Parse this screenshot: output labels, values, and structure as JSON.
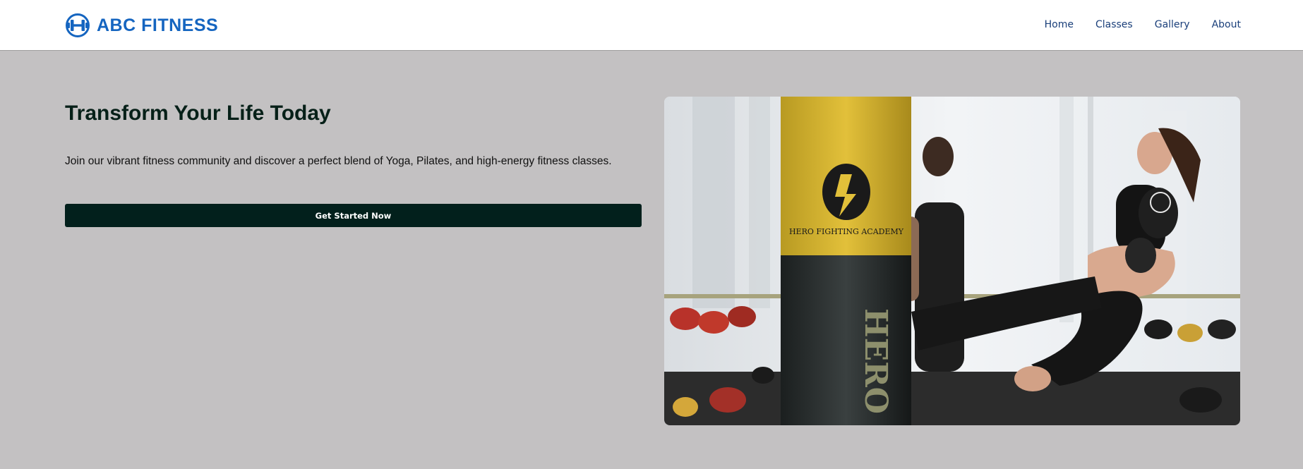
{
  "brand": {
    "name": "ABC FITNESS",
    "logo_icon": "dumbbell-icon",
    "color": "#1565c0"
  },
  "nav": {
    "items": [
      {
        "label": "Home"
      },
      {
        "label": "Classes"
      },
      {
        "label": "Gallery"
      },
      {
        "label": "About"
      }
    ]
  },
  "hero": {
    "title": "Transform Your Life Today",
    "description": "Join our vibrant fitness community and discover a perfect blend of Yoga, Pilates, and high-energy fitness classes.",
    "cta_label": "Get Started Now",
    "image_alt": "Kickboxing training with a punching bag in a gym",
    "bag_brand_text": "HERO FIGHTING ACADEMY",
    "bag_vertical_text": "HERO FIG",
    "colors": {
      "background": "#c3c1c2",
      "cta_background": "#02201c",
      "title": "#062018"
    }
  }
}
